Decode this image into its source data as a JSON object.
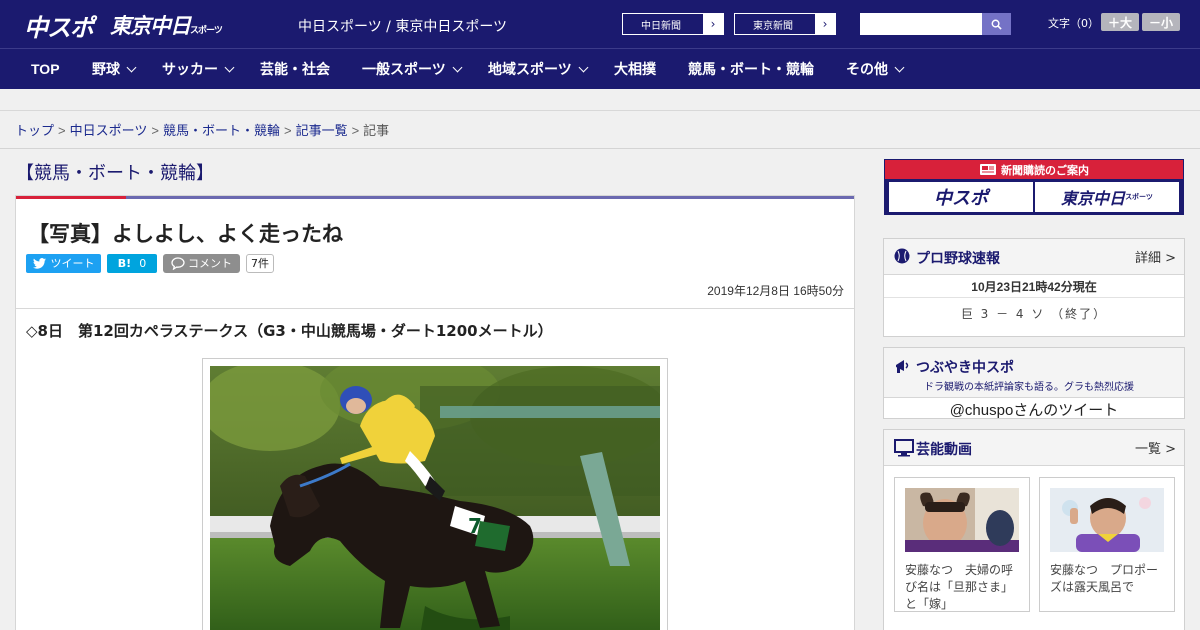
{
  "header": {
    "logo_chuspo": "中スポ",
    "logo_tokyo": "東京中日",
    "logo_tokyo_sub": "スポーツ",
    "site_names": "中日スポーツ / 東京中日スポーツ",
    "external_links": [
      {
        "label": "中日新聞"
      },
      {
        "label": "東京新聞"
      }
    ],
    "search_placeholder": "",
    "font_size_label": "文字（0）",
    "font_bigger": "＋大",
    "font_smaller": "－小"
  },
  "nav": {
    "items": [
      {
        "label": "TOP"
      },
      {
        "label": "野球"
      },
      {
        "label": "サッカー"
      },
      {
        "label": "芸能・社会"
      },
      {
        "label": "一般スポーツ"
      },
      {
        "label": "地域スポーツ"
      },
      {
        "label": "大相撲"
      },
      {
        "label": "競馬・ボート・競輪"
      },
      {
        "label": "その他"
      }
    ]
  },
  "breadcrumb": {
    "items": [
      "トップ",
      "中日スポーツ",
      "競馬・ボート・競輪",
      "記事一覧",
      "記事"
    ],
    "separator": ">"
  },
  "article": {
    "category": "【競馬・ボート・競輪】",
    "title": "【写真】よしよし、よく走ったね",
    "tweet_label": "ツイート",
    "hatena_label": "B!",
    "hatena_count": "0",
    "comment_label": "コメント",
    "comment_count": "7件",
    "date": "2019年12月8日 16時50分",
    "race_line": "◇8日　第12回カペラステークス（G3・中山競馬場・ダート1200メートル）",
    "photo_bib": "7"
  },
  "sidebar": {
    "subscription": {
      "banner_title": "新聞購読のご案内",
      "logo_1": "中スポ",
      "logo_2": "東京中日",
      "logo_2_sub": "スポーツ"
    },
    "baseball": {
      "title": "プロ野球速報",
      "link": "詳細 >",
      "as_of": "10月23日21時42分現在",
      "score": "巨 3 － 4 ソ （終了）"
    },
    "tweets": {
      "title": "つぶやき中スポ",
      "subtitle": "ドラ観戦の本紙評論家も語る。グラも熱烈応援",
      "handle": "@chuspoさんのツイート"
    },
    "videos": {
      "title": "芸能動画",
      "link": "一覧 >",
      "items": [
        {
          "caption": "安藤なつ　夫婦の呼び名は「旦那さま」と「嫁」"
        },
        {
          "caption": "安藤なつ　プロポーズは露天風呂で"
        }
      ]
    }
  },
  "colors": {
    "header_bg": "#1b1a6f",
    "accent_red": "#d8213a",
    "tweet_blue": "#1da1f2",
    "hatena_blue": "#00a4de"
  }
}
